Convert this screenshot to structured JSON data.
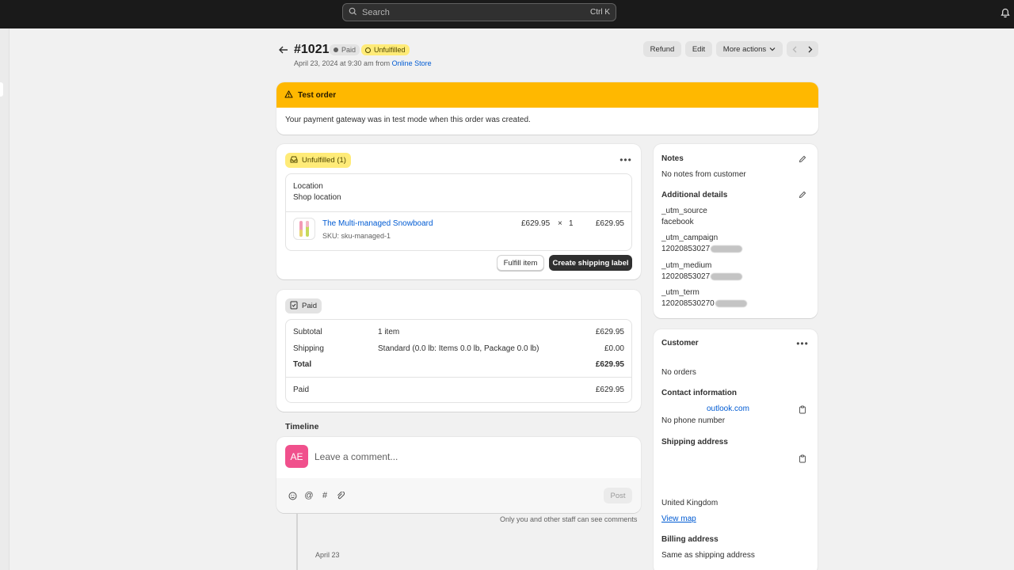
{
  "topbar": {
    "search_placeholder": "Search",
    "search_shortcut": "Ctrl K",
    "notification_icon": "bell-icon"
  },
  "header": {
    "back_icon": "arrow-left-icon",
    "order_number": "#1021",
    "payment_badge": "Paid",
    "fulfillment_badge": "Unfulfilled",
    "date_text": "April 23, 2024 at 9:30 am from",
    "channel_link": "Online Store",
    "refund_label": "Refund",
    "edit_label": "Edit",
    "more_actions_label": "More actions"
  },
  "test_banner": {
    "title": "Test order",
    "message": "Your payment gateway was in test mode when this order was created."
  },
  "fulfillment": {
    "status_label": "Unfulfilled (1)",
    "location_label": "Location",
    "location_value": "Shop location",
    "item": {
      "name": "The Multi-managed Snowboard",
      "sku": "SKU: sku-managed-1",
      "price": "£629.95",
      "times": "×",
      "quantity": "1",
      "total": "£629.95"
    },
    "fulfill_button": "Fulfill item",
    "shipping_label_button": "Create shipping label"
  },
  "payment": {
    "status_label": "Paid",
    "rows": [
      {
        "label": "Subtotal",
        "detail": "1 item",
        "amount": "£629.95"
      },
      {
        "label": "Shipping",
        "detail": "Standard (0.0 lb: Items 0.0 lb, Package 0.0 lb)",
        "amount": "£0.00"
      },
      {
        "label": "Total",
        "detail": "",
        "amount": "£629.95"
      }
    ],
    "paid_label": "Paid",
    "paid_amount": "£629.95"
  },
  "timeline": {
    "title": "Timeline",
    "avatar_initials": "AE",
    "comment_placeholder": "Leave a comment...",
    "post_label": "Post",
    "staff_note": "Only you and other staff can see comments",
    "date_label": "April 23"
  },
  "notes": {
    "title": "Notes",
    "empty_text": "No notes from customer",
    "additional_title": "Additional details",
    "details": [
      {
        "key": "_utm_source",
        "value": "facebook"
      },
      {
        "key": "_utm_campaign",
        "value": "12020853027"
      },
      {
        "key": "_utm_medium",
        "value": "12020853027"
      },
      {
        "key": "_utm_term",
        "value": "120208530270"
      }
    ]
  },
  "customer": {
    "title": "Customer",
    "orders_text": "No orders",
    "contact_title": "Contact information",
    "email_text": "outlook.com",
    "phone_text": "No phone number",
    "shipping_title": "Shipping address",
    "country": "United Kingdom",
    "map_link": "View map",
    "billing_title": "Billing address",
    "billing_text": "Same as shipping address"
  },
  "colors": {
    "warning_banner": "#ffb800",
    "unfulfilled_badge": "#ffeb78",
    "link": "#005bd3",
    "avatar": "#f0508c"
  }
}
